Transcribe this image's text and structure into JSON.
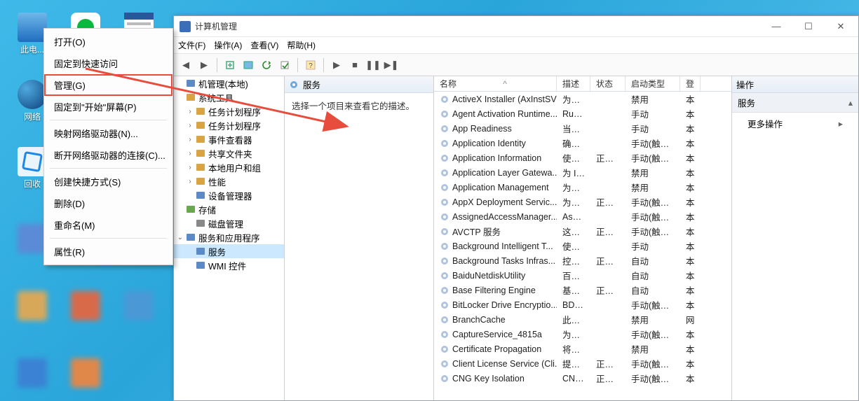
{
  "desktop": {
    "icons": [
      {
        "label": "此电...",
        "glyphbg": "#2b7cd3"
      },
      {
        "label": "",
        "glyphbg": "#fff"
      },
      {
        "label": "",
        "glyphbg": "#2b7cd3"
      },
      {
        "label": "网络",
        "glyphbg": "#1b4f9c"
      },
      {
        "label": "",
        "glyphbg": "#fff"
      },
      {
        "label": "回收",
        "glyphbg": "#3aa0e0"
      }
    ]
  },
  "context_menu": {
    "items": [
      {
        "label": "打开(O)"
      },
      {
        "label": "固定到快速访问"
      },
      {
        "label": "管理(G)",
        "hot": true
      },
      {
        "label": "固定到\"开始\"屏幕(P)"
      },
      {
        "sep": true
      },
      {
        "label": "映射网络驱动器(N)..."
      },
      {
        "label": "断开网络驱动器的连接(C)..."
      },
      {
        "sep": true
      },
      {
        "label": "创建快捷方式(S)"
      },
      {
        "label": "删除(D)"
      },
      {
        "label": "重命名(M)"
      },
      {
        "sep": true
      },
      {
        "label": "属性(R)"
      }
    ]
  },
  "window": {
    "title": "计算机管理",
    "menus": [
      "文件(F)",
      "操作(A)",
      "查看(V)",
      "帮助(H)"
    ]
  },
  "tree": [
    {
      "ind": 0,
      "tw": "",
      "label": "机管理(本地)"
    },
    {
      "ind": 0,
      "tw": "",
      "label": "系统工具"
    },
    {
      "ind": 1,
      "tw": "›",
      "label": "任务计划程序"
    },
    {
      "ind": 1,
      "tw": "›",
      "label": "任务计划程序"
    },
    {
      "ind": 1,
      "tw": "›",
      "label": "事件查看器"
    },
    {
      "ind": 1,
      "tw": "›",
      "label": "共享文件夹"
    },
    {
      "ind": 1,
      "tw": "›",
      "label": "本地用户和组"
    },
    {
      "ind": 1,
      "tw": "›",
      "label": "性能"
    },
    {
      "ind": 1,
      "tw": "",
      "label": "设备管理器"
    },
    {
      "ind": 0,
      "tw": "",
      "label": "存储"
    },
    {
      "ind": 1,
      "tw": "",
      "label": "磁盘管理"
    },
    {
      "ind": 0,
      "tw": "⌄",
      "label": "服务和应用程序"
    },
    {
      "ind": 1,
      "tw": "",
      "label": "服务",
      "sel": true
    },
    {
      "ind": 1,
      "tw": "",
      "label": "WMI 控件"
    }
  ],
  "mid": {
    "header": "服务",
    "desc": "选择一个项目来查看它的描述。",
    "columns": {
      "name": "名称",
      "desc": "描述",
      "state": "状态",
      "start": "启动类型",
      "logon": "登"
    },
    "sort_asc": "^"
  },
  "services": [
    {
      "n": "ActiveX Installer (AxInstSV)",
      "d": "为从 ...",
      "s": "",
      "t": "禁用",
      "l": "本"
    },
    {
      "n": "Agent Activation Runtime...",
      "d": "Runt...",
      "s": "",
      "t": "手动",
      "l": "本"
    },
    {
      "n": "App Readiness",
      "d": "当用 ...",
      "s": "",
      "t": "手动",
      "l": "本"
    },
    {
      "n": "Application Identity",
      "d": "确定 ...",
      "s": "",
      "t": "手动(触发...",
      "l": "本"
    },
    {
      "n": "Application Information",
      "d": "使用 ...",
      "s": "正在...",
      "t": "手动(触发...",
      "l": "本"
    },
    {
      "n": "Application Layer Gatewa...",
      "d": "为 In...",
      "s": "",
      "t": "禁用",
      "l": "本"
    },
    {
      "n": "Application Management",
      "d": "为通 ...",
      "s": "",
      "t": "禁用",
      "l": "本"
    },
    {
      "n": "AppX Deployment Servic...",
      "d": "为部 ...",
      "s": "正在...",
      "t": "手动(触发...",
      "l": "本"
    },
    {
      "n": "AssignedAccessManager...",
      "d": "Assi...",
      "s": "",
      "t": "手动(触发...",
      "l": "本"
    },
    {
      "n": "AVCTP 服务",
      "d": "这是 ...",
      "s": "正在...",
      "t": "手动(触发...",
      "l": "本"
    },
    {
      "n": "Background Intelligent T...",
      "d": "使用 ...",
      "s": "",
      "t": "手动",
      "l": "本"
    },
    {
      "n": "Background Tasks Infras...",
      "d": "控制 ...",
      "s": "正在...",
      "t": "自动",
      "l": "本"
    },
    {
      "n": "BaiduNetdiskUtility",
      "d": "百度 ...",
      "s": "",
      "t": "自动",
      "l": "本"
    },
    {
      "n": "Base Filtering Engine",
      "d": "基本 ...",
      "s": "正在...",
      "t": "自动",
      "l": "本"
    },
    {
      "n": "BitLocker Drive Encryptio...",
      "d": "BDE...",
      "s": "",
      "t": "手动(触发...",
      "l": "本"
    },
    {
      "n": "BranchCache",
      "d": "此服 ...",
      "s": "",
      "t": "禁用",
      "l": "网"
    },
    {
      "n": "CaptureService_4815a",
      "d": "为调 ...",
      "s": "",
      "t": "手动(触发...",
      "l": "本"
    },
    {
      "n": "Certificate Propagation",
      "d": "将用 ...",
      "s": "",
      "t": "禁用",
      "l": "本"
    },
    {
      "n": "Client License Service (Cli...",
      "d": "提供 ...",
      "s": "正在...",
      "t": "手动(触发...",
      "l": "本"
    },
    {
      "n": "CNG Key Isolation",
      "d": "CNG...",
      "s": "正在...",
      "t": "手动(触发...",
      "l": "本"
    }
  ],
  "right": {
    "header": "操作",
    "section": "服务",
    "action": "更多操作"
  }
}
